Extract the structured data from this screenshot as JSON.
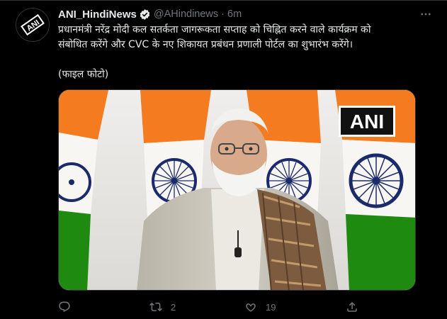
{
  "tweet": {
    "avatar_label": "ANI",
    "display_name": "ANI_HindiNews",
    "handle": "@AHindinews",
    "separator": "·",
    "time": "6m",
    "text_line1": "प्रधानमंत्री नरेंद्र मोदी कल सतर्कता जागरूकता सप्ताह को चिह्नित करने वाले कार्यक्रम को",
    "text_line2": "संबोधित करेंगे और CVC के नए शिकायत प्रबंधन प्रणाली पोर्टल का शुभारंभ करेंगे।",
    "text_caption": "(फाइल फोटो)",
    "media": {
      "watermark": "ANI"
    },
    "actions": {
      "reply": {
        "icon": "reply-icon",
        "count": ""
      },
      "retweet": {
        "icon": "retweet-icon",
        "count": "2"
      },
      "like": {
        "icon": "heart-icon",
        "count": "19"
      },
      "share": {
        "icon": "share-icon",
        "count": ""
      }
    }
  },
  "colors": {
    "background": "#000000",
    "text": "#e7e9ea",
    "secondary": "#71767b",
    "verified": "#1d9bf0",
    "saffron": "#f47b20",
    "green": "#138808",
    "chakra": "#1b2a6b"
  }
}
